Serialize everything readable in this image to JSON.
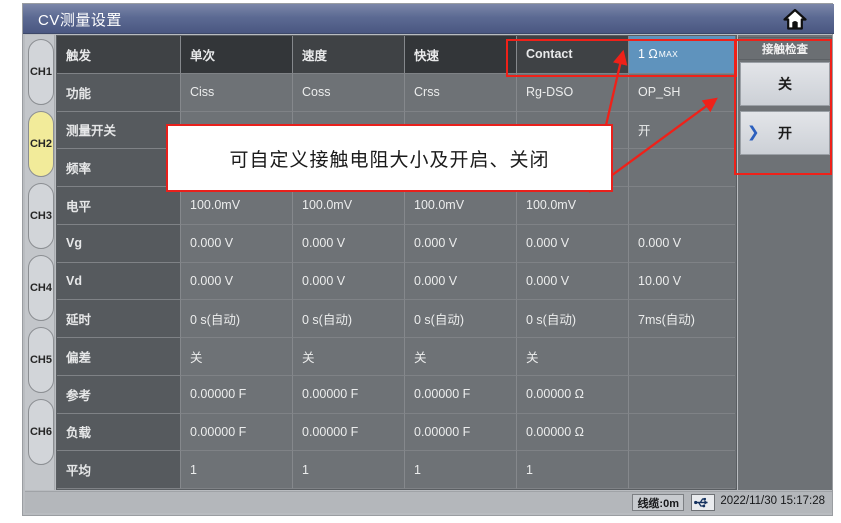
{
  "window": {
    "title": "CV测量设置",
    "home_icon": "home-icon"
  },
  "channels": {
    "items": [
      {
        "label": "CH1",
        "active": false
      },
      {
        "label": "CH2",
        "active": true
      },
      {
        "label": "CH3",
        "active": false
      },
      {
        "label": "CH4",
        "active": false
      },
      {
        "label": "CH5",
        "active": false
      },
      {
        "label": "CH6",
        "active": false
      }
    ]
  },
  "table": {
    "header": [
      "触发",
      "单次",
      "速度",
      "快速",
      "Contact",
      "1 Ω"
    ],
    "header_last_sub": "MAX",
    "rows": [
      {
        "label": "功能",
        "values": [
          "Ciss",
          "Coss",
          "Crss",
          "Rg-DSO",
          "OP_SH"
        ]
      },
      {
        "label": "测量开关",
        "values": [
          "",
          "",
          "",
          "",
          "开"
        ]
      },
      {
        "label": "频率",
        "values": [
          "",
          "",
          "",
          "",
          ""
        ]
      },
      {
        "label": "电平",
        "values": [
          "100.0mV",
          "100.0mV",
          "100.0mV",
          "100.0mV",
          ""
        ]
      },
      {
        "label": "Vg",
        "values": [
          "0.000 V",
          "0.000 V",
          "0.000 V",
          "0.000 V",
          "0.000 V"
        ]
      },
      {
        "label": "Vd",
        "values": [
          "0.000 V",
          "0.000 V",
          "0.000 V",
          "0.000 V",
          "10.00 V"
        ]
      },
      {
        "label": "延时",
        "values": [
          "0 s(自动)",
          "0 s(自动)",
          "0 s(自动)",
          "0 s(自动)",
          "7ms(自动)"
        ]
      },
      {
        "label": "偏差",
        "values": [
          "关",
          "关",
          "关",
          "关",
          ""
        ]
      },
      {
        "label": "参考",
        "values": [
          "0.00000 F",
          "0.00000 F",
          "0.00000 F",
          "0.00000 Ω",
          ""
        ]
      },
      {
        "label": "负载",
        "values": [
          "0.00000 F",
          "0.00000 F",
          "0.00000 F",
          "0.00000 Ω",
          ""
        ]
      },
      {
        "label": "平均",
        "values": [
          "1",
          "1",
          "1",
          "1",
          ""
        ]
      }
    ]
  },
  "side_panel": {
    "title": "接触检查",
    "buttons": [
      {
        "label": "关",
        "marked": false
      },
      {
        "label": "开",
        "marked": true,
        "marker": "❯"
      }
    ]
  },
  "status": {
    "cable": "线缆:0m",
    "usb_icon": "usb-icon",
    "timestamp": "2022/11/30 15:17:28"
  },
  "annotation": {
    "callout_text": "可自定义接触电阻大小及开启、关闭",
    "accent_color": "#ef2119"
  }
}
